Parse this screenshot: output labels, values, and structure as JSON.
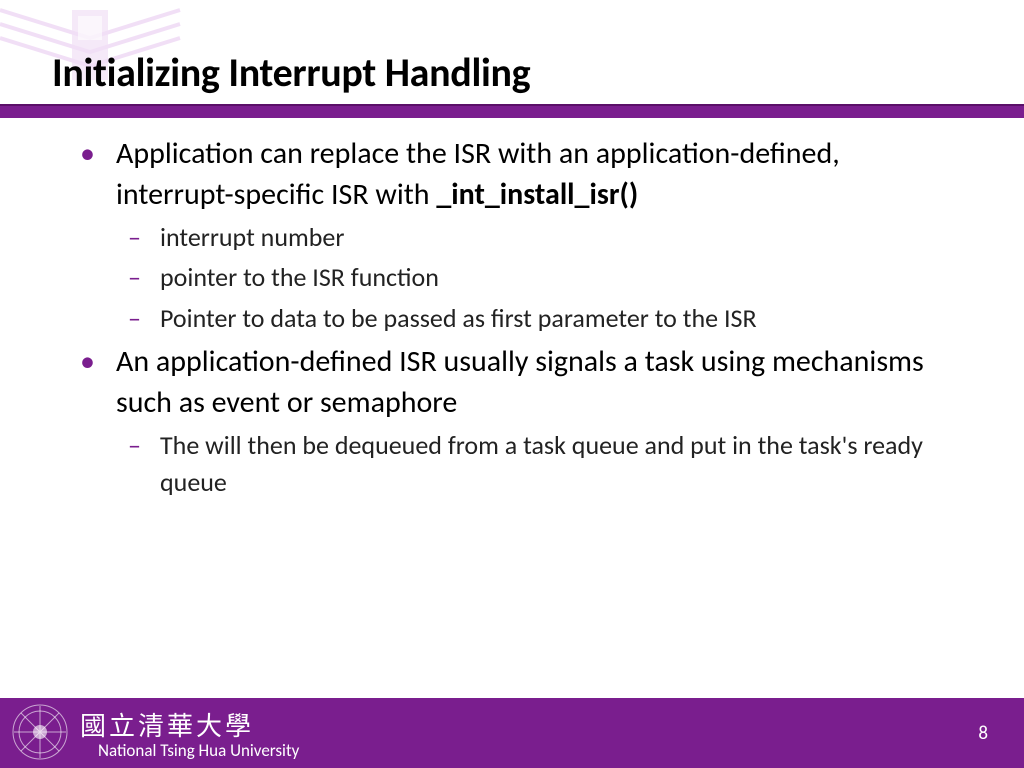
{
  "title": "Initializing Interrupt Handling",
  "bullets": [
    {
      "pre": "Application can replace the ISR with an application-defined, interrupt-specific ISR with ",
      "bold": "_int_install_isr()",
      "sub": [
        "interrupt number",
        "pointer to the ISR function",
        "Pointer to data to be passed as first parameter to the ISR"
      ]
    },
    {
      "pre": "An application-defined ISR usually signals a task using mechanisms such as event or semaphore",
      "bold": "",
      "sub": [
        "The will then be dequeued from a task queue and put in the task's ready queue"
      ]
    }
  ],
  "footer": {
    "uni_cn": "國立清華大學",
    "uni_en": "National Tsing Hua University",
    "page": "8"
  }
}
